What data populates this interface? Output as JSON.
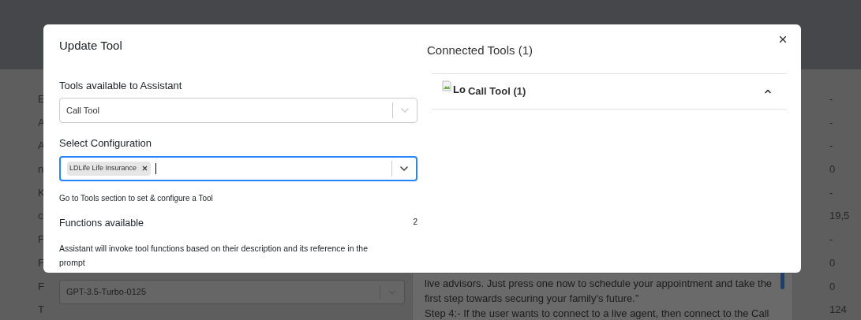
{
  "background": {
    "row_labels": [
      "E",
      "A",
      "A",
      "n",
      "K",
      "c",
      "F",
      "F",
      "F",
      "T"
    ],
    "row_values": [
      "-",
      "-",
      "-",
      "0",
      "-",
      "19,5",
      "-",
      "0",
      "0",
      "124"
    ],
    "model_select": {
      "value": "GPT-3.5-Turbo-0125"
    },
    "prompt_lines": [
      "live advisors. Just press one now to schedule your appointment and take the",
      "first step towards securing your family's future.”",
      "Step 4:- If the user wants to connect to a live agent, then connect to the Call"
    ]
  },
  "dialog": {
    "title": "Update Tool",
    "tools_field": {
      "label": "Tools available to Assistant",
      "value": "Call Tool",
      "focused": false
    },
    "config_field": {
      "label": "Select Configuration",
      "focused": true,
      "tags": [
        {
          "label": "LDLife Life Insurance"
        }
      ]
    },
    "hint": "Go to Tools section to set & configure a Tool",
    "functions": {
      "label": "Functions available",
      "count": "2",
      "description": "Assistant will invoke tool functions based on their description and its reference in the prompt"
    },
    "connected": {
      "title": "Connected Tools (1)",
      "items": [
        {
          "image_alt": "Lo",
          "label": "Call Tool (1)",
          "expanded": true
        }
      ]
    }
  }
}
